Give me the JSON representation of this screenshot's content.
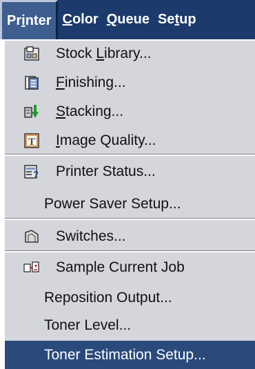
{
  "menubar": {
    "items": [
      {
        "pre": "Pr",
        "u": "i",
        "post": "nter"
      },
      {
        "pre": "",
        "u": "C",
        "post": "olor"
      },
      {
        "pre": "",
        "u": "Q",
        "post": "ueue"
      },
      {
        "pre": "Se",
        "u": "t",
        "post": "up"
      }
    ]
  },
  "menu": {
    "items": [
      {
        "pre": "Stock ",
        "u": "L",
        "post": "ibrary...",
        "icon": "stock-library-icon"
      },
      {
        "pre": "",
        "u": "F",
        "post": "inishing...",
        "icon": "finishing-icon"
      },
      {
        "pre": "",
        "u": "S",
        "post": "tacking...",
        "icon": "stacking-icon"
      },
      {
        "pre": "",
        "u": "I",
        "post": "mage Quality...",
        "icon": "image-quality-icon"
      },
      {
        "pre": "Printer Status...",
        "u": "",
        "post": "",
        "icon": "printer-status-icon"
      },
      {
        "pre": "Power Saver Setup...",
        "u": "",
        "post": ""
      },
      {
        "pre": "Switches...",
        "u": "",
        "post": "",
        "icon": "switches-icon"
      },
      {
        "pre": "Sample Current Job",
        "u": "",
        "post": "",
        "icon": "sample-job-icon"
      },
      {
        "pre": "Reposition Output...",
        "u": "",
        "post": ""
      },
      {
        "pre": "Toner Level...",
        "u": "",
        "post": ""
      },
      {
        "pre": "Toner Estimation Setup...",
        "u": "",
        "post": ""
      }
    ],
    "selected": "Toner Estimation Setup..."
  },
  "colors": {
    "menubar_bg": "#1c3a6b",
    "menu_bg": "#d4d6dc",
    "selection_bg": "#2a4a7c"
  }
}
